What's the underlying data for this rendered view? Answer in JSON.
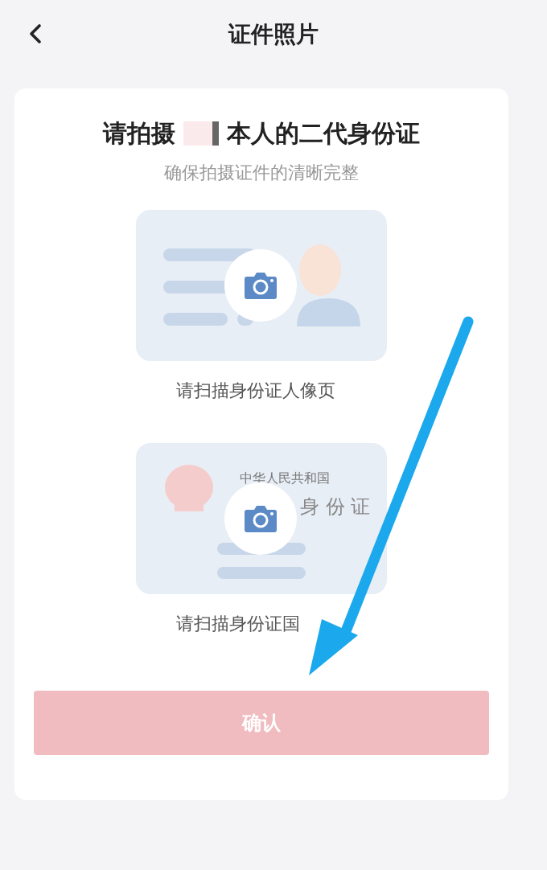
{
  "header": {
    "title": "证件照片"
  },
  "card": {
    "title_before": "请拍摄",
    "title_after": "本人的二代身份证",
    "subtitle": "确保拍摄证件的清晰完整",
    "slots": [
      {
        "kind": "front",
        "caption": "请扫描身份证人像页"
      },
      {
        "kind": "back",
        "caption": "请扫描身份证国",
        "line_1": "中华人民共和国",
        "line_2": "身 份 证"
      }
    ],
    "confirm": {
      "label": "确认",
      "disabled": true
    }
  }
}
